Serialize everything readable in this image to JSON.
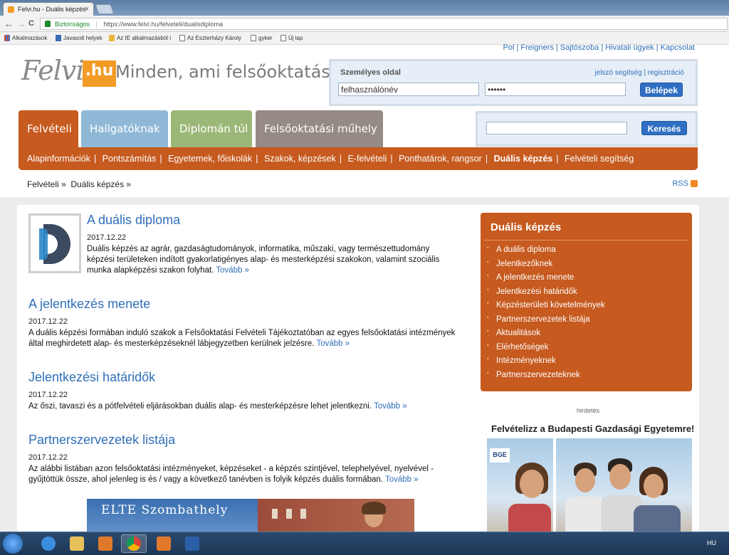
{
  "browser": {
    "tab_title": "Felvi.hu - Duális képzés",
    "tab_close": "×",
    "url_secure": "Biztonságos",
    "url_separator": "|",
    "url": "https://www.felvi.hu/felveteli/dualisdiploma",
    "nav_back": "←",
    "nav_forward": "→",
    "nav_reload": "C",
    "bookmarks": [
      "Alkalmazások",
      "Javasolt helyek",
      "Az IE alkalmazásból i",
      "Az Eszterházy Károly",
      "gyker",
      "Új lap"
    ]
  },
  "header": {
    "top_links": "Pol | Freigners | Sajtószoba | Hivatali ügyek | Kapcsolat",
    "logo_text": "Felvi",
    "logo_badge": ".hu",
    "slogan": "Minden, ami felsőoktatás",
    "login": {
      "title": "Személyes oldal",
      "link_password": "jelszó segítség",
      "link_sep": "|",
      "link_register": "regisztráció",
      "username_value": "felhasználónév",
      "password_value": "••••••",
      "submit": "Belépek"
    },
    "search": {
      "value": "",
      "button": "Keresés"
    }
  },
  "main_tabs": [
    {
      "label": "Felvételi",
      "color": "#c65a1f"
    },
    {
      "label": "Hallgatóknak",
      "color": "#8fb8d6"
    },
    {
      "label": "Diplomán túl",
      "color": "#9cb878"
    },
    {
      "label": "Felsőoktatási műhely",
      "color": "#958a84"
    }
  ],
  "subnav": {
    "items": [
      "Alapinformációk",
      "Pontszámítás",
      "Egyetemek, főiskolák",
      "Szakok, képzések",
      "E-felvételi",
      "Ponthatárok, rangsor",
      "Duális képzés",
      "Felvételi segítség"
    ],
    "separator": "|",
    "active": "Duális képzés"
  },
  "breadcrumb": {
    "item1": "Felvételi »",
    "item2": "Duális képzés »"
  },
  "rss_label": "RSS",
  "articles": [
    {
      "title": "A duális diploma",
      "date": "2017.12.22",
      "text": "Duális képzés az agrár, gazdaságtudományok, informatika, műszaki, vagy természettudomány képzési területeken indított gyakorlatigényes alap- és mesterképzési szakokon, valamint szociális munka alapképzési szakon folyhat.",
      "more": "Tovább »"
    },
    {
      "title": "A jelentkezés menete",
      "date": "2017.12.22",
      "text": "A duális képzési formában induló szakok a Felsőoktatási Felvételi Tájékoztatóban az egyes felsőoktatási intézmények által meghirdetett alap- és mesterképzéseknél lábjegyzetben kerülnek jelzésre.",
      "more": "Tovább »"
    },
    {
      "title": "Jelentkezési határidők",
      "date": "2017.12.22",
      "text": "Az őszi, tavaszi és a pótfelvételi eljárásokban duális alap- és mesterképzésre lehet jelentkezni.",
      "more": "Tovább »"
    },
    {
      "title": "Partnerszervezetek listája",
      "date": "2017.12.22",
      "text": "Az alábbi listában azon felsőoktatási intézményeket, képzéseket - a képzés szintjével, telephelyével, nyelvével - gyűjtöttük össze, ahol jelenleg is és / vagy a következő tanévben is folyik képzés duális formában.",
      "more": "Tovább »"
    }
  ],
  "sidebar": {
    "title": "Duális képzés",
    "items": [
      "A duális diploma",
      "Jelentkezőknek",
      "A jelentkezés menete",
      "Jelentkezési határidők",
      "Képzésterületi követelmények",
      "Partnerszervezetek listája",
      "Aktualitások",
      "Elérhetőségek",
      "Intézményeknek",
      "Partnerszervezeteknek"
    ]
  },
  "ad": {
    "label": "hirdetés",
    "title": "Felvételizz a Budapesti Gazdasági Egyetemre!",
    "logo": "BGE"
  },
  "banner": {
    "text": "ELTE Szombathely"
  },
  "taskbar": {
    "tray_text": "HU"
  }
}
